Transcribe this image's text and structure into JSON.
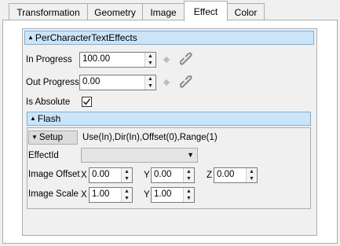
{
  "tabs": [
    {
      "label": "Transformation",
      "active": false
    },
    {
      "label": "Geometry",
      "active": false
    },
    {
      "label": "Image",
      "active": false
    },
    {
      "label": "Effect",
      "active": true
    },
    {
      "label": "Color",
      "active": false
    }
  ],
  "effect_section": {
    "title": "PerCharacterTextEffects",
    "collapse_icon": "triangle-up-icon",
    "in_progress": {
      "label": "In Progress",
      "value": "100.00"
    },
    "out_progress": {
      "label": "Out Progress",
      "value": "0.00"
    },
    "is_absolute": {
      "label": "Is Absolute",
      "checked": true
    },
    "keyframe_icon": "diamond-icon",
    "link_icon": "chain-link-icon"
  },
  "flash_section": {
    "title": "Flash",
    "collapse_icon": "triangle-up-icon",
    "setup_button": "Setup",
    "setup_icon": "triangle-down-icon",
    "setup_summary": "Use(In),Dir(In),Offset(0),Range(1)",
    "effect_id": {
      "label": "EffectId",
      "value": ""
    },
    "image_offset": {
      "label": "Image Offset",
      "x_label": "X",
      "x_value": "0.00",
      "y_label": "Y",
      "y_value": "0.00",
      "z_label": "Z",
      "z_value": "0.00"
    },
    "image_scale": {
      "label": "Image Scale",
      "x_label": "X",
      "x_value": "1.00",
      "y_label": "Y",
      "y_value": "1.00"
    }
  },
  "colors": {
    "section_header_bg": "#cce4f7",
    "section_header_border": "#7ab0dd",
    "panel_bg": "#f0f0f0"
  }
}
